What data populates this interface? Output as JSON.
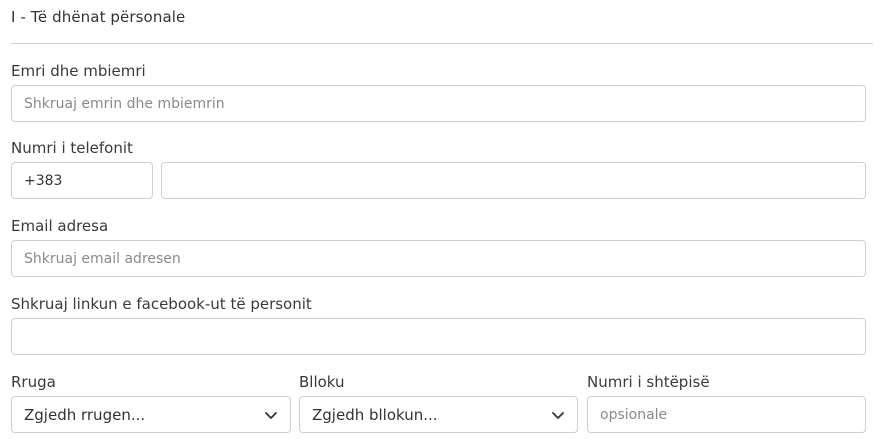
{
  "section": {
    "title": "I - Të dhënat përsonale"
  },
  "fields": {
    "full_name": {
      "label": "Emri dhe mbiemri",
      "placeholder": "Shkruaj emrin dhe mbiemrin",
      "value": ""
    },
    "phone": {
      "label": "Numri i telefonit",
      "prefix_value": "+383",
      "number_value": ""
    },
    "email": {
      "label": "Email adresa",
      "placeholder": "Shkruaj email adresen",
      "value": ""
    },
    "facebook": {
      "label": "Shkruaj linkun e facebook-ut të personit",
      "value": ""
    },
    "street": {
      "label": "Rruga",
      "selected": "Zgjedh rrugen..."
    },
    "block": {
      "label": "Blloku",
      "selected": "Zgjedh bllokun..."
    },
    "house_number": {
      "label": "Numri i shtëpisë",
      "placeholder": "opsionale",
      "value": ""
    }
  },
  "icons": {
    "select_arrow": "chevron-down-icon"
  },
  "colors": {
    "border": "#cfcfcf",
    "text": "#333333",
    "placeholder": "#8a8a8a",
    "divider": "#cfcfcf"
  }
}
